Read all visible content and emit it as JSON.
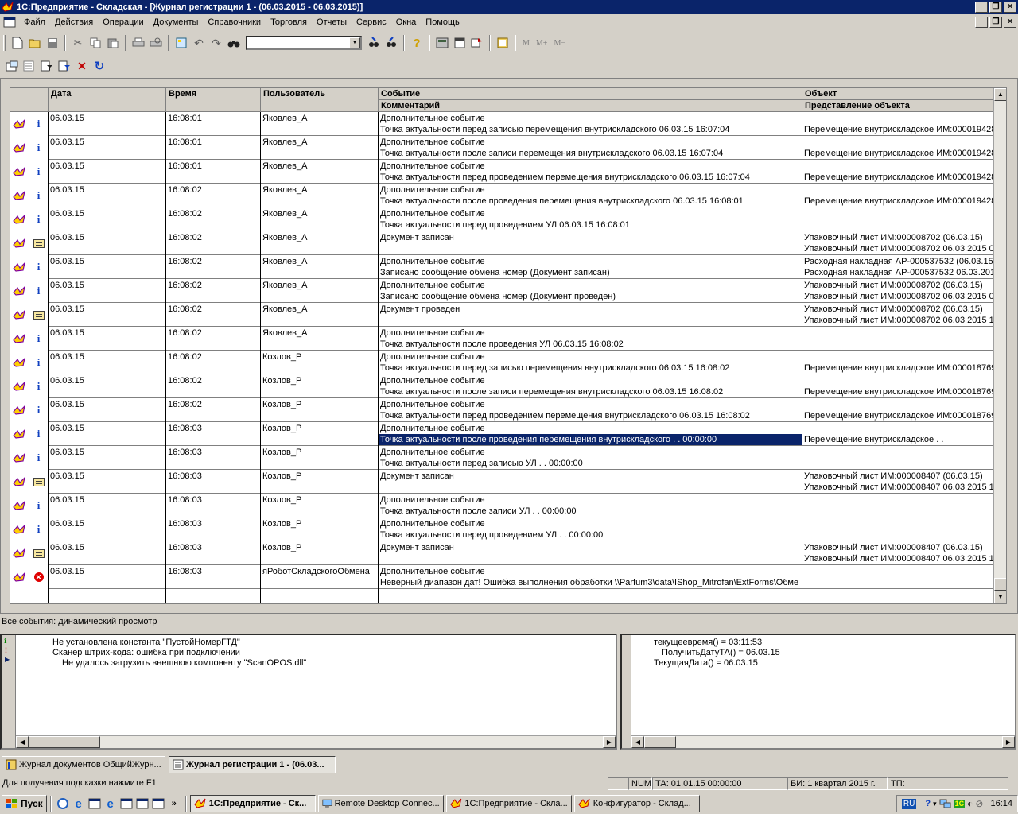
{
  "window": {
    "title": "1С:Предприятие - Складская - [Журнал регистрации 1 - (06.03.2015 - 06.03.2015)]"
  },
  "menu": [
    "Файл",
    "Действия",
    "Операции",
    "Документы",
    "Справочники",
    "Торговля",
    "Отчеты",
    "Сервис",
    "Окна",
    "Помощь"
  ],
  "toolbar": {
    "search_value": "",
    "m_buttons": [
      "M",
      "M+",
      "M−"
    ]
  },
  "grid": {
    "headers": {
      "date": "Дата",
      "time": "Время",
      "user": "Пользователь",
      "event": "Событие",
      "comment": "Комментарий",
      "object": "Объект",
      "object_repr": "Представление объекта"
    },
    "rows": [
      {
        "icon": "info",
        "date": "06.03.15",
        "time": "16:08:01",
        "user": "Яковлев_А",
        "event": "Дополнительное событие",
        "comment": "Точка актуальности перед записью перемещения внутрискладского 06.03.15 16:07:04",
        "obj1": "",
        "obj2": "Перемещение внутрискладское ИМ:000019428"
      },
      {
        "icon": "info",
        "date": "06.03.15",
        "time": "16:08:01",
        "user": "Яковлев_А",
        "event": "Дополнительное событие",
        "comment": "Точка актуальности после записи перемещения внутрискладского 06.03.15 16:07:04",
        "obj1": "",
        "obj2": "Перемещение внутрискладское ИМ:000019428"
      },
      {
        "icon": "info",
        "date": "06.03.15",
        "time": "16:08:01",
        "user": "Яковлев_А",
        "event": "Дополнительное событие",
        "comment": "Точка актуальности перед проведением перемещения внутрискладского 06.03.15 16:07:04",
        "obj1": "",
        "obj2": "Перемещение внутрискладское ИМ:000019428"
      },
      {
        "icon": "info",
        "date": "06.03.15",
        "time": "16:08:02",
        "user": "Яковлев_А",
        "event": "Дополнительное событие",
        "comment": "Точка актуальности после проведения перемещения внутрискладского 06.03.15 16:08:01",
        "obj1": "",
        "obj2": "Перемещение внутрискладское ИМ:000019428"
      },
      {
        "icon": "info",
        "date": "06.03.15",
        "time": "16:08:02",
        "user": "Яковлев_А",
        "event": "Дополнительное событие",
        "comment": "Точка актуальности перед проведением УЛ 06.03.15 16:08:01",
        "obj1": "",
        "obj2": ""
      },
      {
        "icon": "doc",
        "date": "06.03.15",
        "time": "16:08:02",
        "user": "Яковлев_А",
        "event": "Документ записан",
        "comment": "",
        "obj1": "Упаковочный лист ИМ:000008702 (06.03.15)",
        "obj2": "Упаковочный лист ИМ:000008702 06.03.2015 0"
      },
      {
        "icon": "info",
        "date": "06.03.15",
        "time": "16:08:02",
        "user": "Яковлев_А",
        "event": "Дополнительное событие",
        "comment": "Записано сообщение обмена номер  (Документ записан)",
        "obj1": "Расходная накладная АР-000537532 (06.03.15)",
        "obj2": "Расходная накладная АР-000537532 06.03.201"
      },
      {
        "icon": "info",
        "date": "06.03.15",
        "time": "16:08:02",
        "user": "Яковлев_А",
        "event": "Дополнительное событие",
        "comment": "Записано сообщение обмена номер  (Документ проведен)",
        "obj1": "Упаковочный лист ИМ:000008702 (06.03.15)",
        "obj2": "Упаковочный лист ИМ:000008702 06.03.2015 0"
      },
      {
        "icon": "doc",
        "date": "06.03.15",
        "time": "16:08:02",
        "user": "Яковлев_А",
        "event": "Документ проведен",
        "comment": "",
        "obj1": "Упаковочный лист ИМ:000008702 (06.03.15)",
        "obj2": "Упаковочный лист ИМ:000008702 06.03.2015 1"
      },
      {
        "icon": "info",
        "date": "06.03.15",
        "time": "16:08:02",
        "user": "Яковлев_А",
        "event": "Дополнительное событие",
        "comment": "Точка актуальности после проведения УЛ 06.03.15 16:08:02",
        "obj1": "",
        "obj2": ""
      },
      {
        "icon": "info",
        "date": "06.03.15",
        "time": "16:08:02",
        "user": "Козлов_Р",
        "event": "Дополнительное событие",
        "comment": "Точка актуальности перед записью перемещения внутрискладского 06.03.15 16:08:02",
        "obj1": "",
        "obj2": "Перемещение внутрискладское ИМ:000018769"
      },
      {
        "icon": "info",
        "date": "06.03.15",
        "time": "16:08:02",
        "user": "Козлов_Р",
        "event": "Дополнительное событие",
        "comment": "Точка актуальности после записи перемещения внутрискладского 06.03.15 16:08:02",
        "obj1": "",
        "obj2": "Перемещение внутрискладское ИМ:000018769"
      },
      {
        "icon": "info",
        "date": "06.03.15",
        "time": "16:08:02",
        "user": "Козлов_Р",
        "event": "Дополнительное событие",
        "comment": "Точка актуальности перед проведением перемещения внутрискладского 06.03.15 16:08:02",
        "obj1": "",
        "obj2": "Перемещение внутрискладское ИМ:000018769"
      },
      {
        "icon": "info",
        "date": "06.03.15",
        "time": "16:08:03",
        "user": "Козлов_Р",
        "event": "Дополнительное событие",
        "comment": "Точка актуальности после проведения перемещения внутрискладского   .  .    00:00:00",
        "obj1": "",
        "obj2": "Перемещение внутрискладское   .  .",
        "selected": true
      },
      {
        "icon": "info",
        "date": "06.03.15",
        "time": "16:08:03",
        "user": "Козлов_Р",
        "event": "Дополнительное событие",
        "comment": "Точка актуальности перед записью УЛ   .  .    00:00:00",
        "obj1": "",
        "obj2": ""
      },
      {
        "icon": "doc",
        "date": "06.03.15",
        "time": "16:08:03",
        "user": "Козлов_Р",
        "event": "Документ записан",
        "comment": "",
        "obj1": "Упаковочный лист ИМ:000008407 (06.03.15)",
        "obj2": "Упаковочный лист ИМ:000008407 06.03.2015 1"
      },
      {
        "icon": "info",
        "date": "06.03.15",
        "time": "16:08:03",
        "user": "Козлов_Р",
        "event": "Дополнительное событие",
        "comment": "Точка актуальности после записи УЛ   .  .    00:00:00",
        "obj1": "",
        "obj2": ""
      },
      {
        "icon": "info",
        "date": "06.03.15",
        "time": "16:08:03",
        "user": "Козлов_Р",
        "event": "Дополнительное событие",
        "comment": "Точка актуальности перед проведением УЛ   .  .    00:00:00",
        "obj1": "",
        "obj2": ""
      },
      {
        "icon": "doc",
        "date": "06.03.15",
        "time": "16:08:03",
        "user": "Козлов_Р",
        "event": "Документ записан",
        "comment": "",
        "obj1": "Упаковочный лист ИМ:000008407 (06.03.15)",
        "obj2": "Упаковочный лист ИМ:000008407 06.03.2015 1"
      },
      {
        "icon": "error",
        "date": "06.03.15",
        "time": "16:08:03",
        "user": "яРоботСкладскогоОбмена",
        "event": "Дополнительное событие",
        "comment": "Неверный диапазон дат! Ошибка выполнения обработки \\\\Parfum3\\data\\IShop_Mitrofan\\ExtForms\\Обме",
        "obj1": "",
        "obj2": ""
      }
    ]
  },
  "status_line": "Все события: динамический просмотр",
  "messages_left": [
    "Не установлена константа \"ПустойНомерГТД\"",
    "Сканер штрих-кода: ошибка при подключении",
    "Не удалось загрузить внешнюю компоненту \"ScanOPOS.dll\""
  ],
  "messages_right": [
    "текущеевремя() = 03:11:53",
    "ПолучитьДатуТА() = 06.03.15",
    "ТекущаяДата() = 06.03.15"
  ],
  "window_tabs": [
    {
      "label": "Журнал документов  ОбщийЖурн..."
    },
    {
      "label": "Журнал регистрации 1 - (06.03...",
      "active": true
    }
  ],
  "statusbar": {
    "hint": "Для получения подсказки нажмите F1",
    "num": "NUM",
    "ta": "ТА: 01.01.15  00:00:00",
    "bi": "БИ: 1 квартал 2015 г.",
    "tp": "ТП:"
  },
  "taskbar": {
    "start": "Пуск",
    "tasks": [
      {
        "label": "1С:Предприятие - Ск...",
        "active": true
      },
      {
        "label": "Remote Desktop Connec..."
      },
      {
        "label": "1С:Предприятие - Скла..."
      },
      {
        "label": "Конфигуратор - Склад..."
      }
    ],
    "lang": "RU",
    "clock": "16:14"
  }
}
